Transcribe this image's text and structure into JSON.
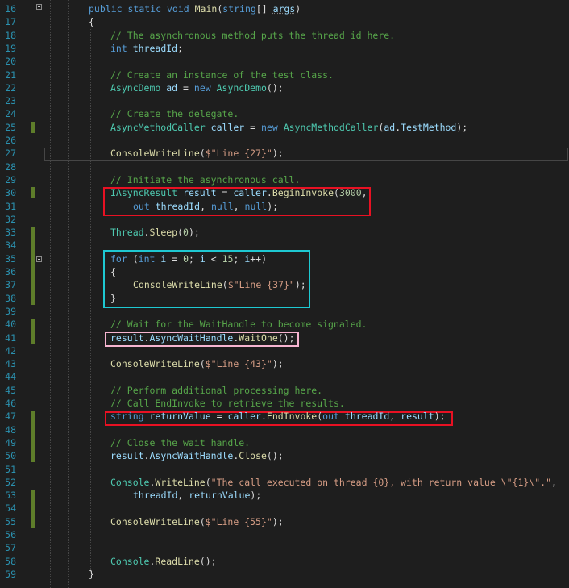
{
  "editor": {
    "line_numbers": [
      "16",
      "17",
      "18",
      "19",
      "20",
      "21",
      "22",
      "23",
      "24",
      "25",
      "26",
      "27",
      "28",
      "29",
      "30",
      "31",
      "32",
      "33",
      "34",
      "35",
      "36",
      "37",
      "38",
      "39",
      "40",
      "41",
      "42",
      "43",
      "44",
      "45",
      "46",
      "47",
      "48",
      "49",
      "50",
      "51",
      "52",
      "53",
      "54",
      "55",
      "56",
      "57",
      "58",
      "59"
    ],
    "code_lines": {
      "l16": "public static void Main(string[] args)",
      "l17": "{",
      "l18": "// The asynchronous method puts the thread id here.",
      "l19": "int threadId;",
      "l21": "// Create an instance of the test class.",
      "l22": "AsyncDemo ad = new AsyncDemo();",
      "l24": "// Create the delegate.",
      "l25": "AsyncMethodCaller caller = new AsyncMethodCaller(ad.TestMethod);",
      "l27": "ConsoleWriteLine($\"Line {27}\");",
      "l29": "// Initiate the asynchronous call.",
      "l30": "IAsyncResult result = caller.BeginInvoke(3000,",
      "l31": "out threadId, null, null);",
      "l33": "Thread.Sleep(0);",
      "l35": "for (int i = 0; i < 15; i++)",
      "l36": "{",
      "l37": "ConsoleWriteLine($\"Line {37}\");",
      "l38": "}",
      "l40": "// Wait for the WaitHandle to become signaled.",
      "l41": "result.AsyncWaitHandle.WaitOne();",
      "l43": "ConsoleWriteLine($\"Line {43}\");",
      "l45": "// Perform additional processing here.",
      "l46": "// Call EndInvoke to retrieve the results.",
      "l47": "string returnValue = caller.EndInvoke(out threadId, result);",
      "l49": "// Close the wait handle.",
      "l50": "result.AsyncWaitHandle.Close();",
      "l52": "Console.WriteLine(\"The call executed on thread {0}, with return value \\\"{1}\\\".\",",
      "l53": "threadId, returnValue);",
      "l55": "ConsoleWriteLine($\"Line {55}\");",
      "l58": "Console.ReadLine();",
      "l59": "}"
    }
  },
  "colors": {
    "background": "#1e1e1e",
    "line_number": "#2b91af",
    "keyword": "#569cd6",
    "type": "#4ec9b0",
    "comment": "#57a64a",
    "string": "#d69d85",
    "number": "#b5cea8",
    "method": "#dcdcaa",
    "parameter": "#9cdcfe",
    "change_marker": "#5e7d2a",
    "highlight_red": "#e81123",
    "highlight_cyan": "#1ec8d2",
    "highlight_pink": "#f6b4d0"
  }
}
